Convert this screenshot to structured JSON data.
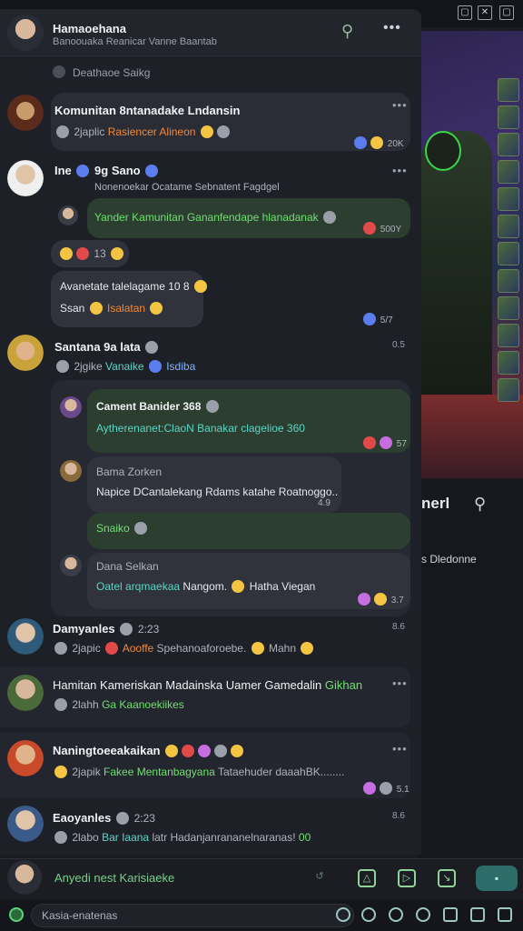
{
  "window": {
    "controls": [
      "▢",
      "✕",
      "▢"
    ]
  },
  "header": {
    "title": "Hamaoehana",
    "subtitle": "Banoouaka Reanicar Vanne Baantab",
    "search_icon": "search-icon",
    "more_label": "•••"
  },
  "system_notice": "Deathaoe Saikg",
  "group_card": {
    "name": "Komunitan 8ntanadake Lndansin",
    "sub_prefix": "2japlic",
    "sub_colored": "Rasiencer Alineon",
    "reactions": "20K",
    "more": "•••"
  },
  "thread1": {
    "name": "Ine",
    "name_extra": "9g Sano",
    "quoted": "Nonenoekar Ocatame Sebnatent Fagdgel",
    "green_msg": "Yander Kamunitan Gananfendape hlanadanak",
    "green_react": "500Y",
    "emoji_count": "13",
    "bubble_line1": "Avanetate talelagame 10 8",
    "bubble_line2_prefix": "Ssan",
    "bubble_line2_colored": "Isalatan",
    "bubble_react": "5/7"
  },
  "thread2": {
    "name": "Santana 9a lata",
    "time": "0.5",
    "sub_prefix": "2jgike",
    "sub_colored": "Vanaike",
    "sub_tail": "Isdiba",
    "quote_card": {
      "name": "Cament Banider 368",
      "text": "Aytherenanet:ClaoN Banakar clagelioe 360",
      "react": "57"
    },
    "reply1": {
      "name": "Bama Zorken",
      "text": "Napice DCantalekang Rdams katahe Roatnoggo..",
      "react": "4.9"
    },
    "reply2": {
      "text": "Snaiko"
    },
    "reply3": {
      "name": "Dana Selkan",
      "text_prefix": "Oatel arqmaekaa",
      "text_mid": "Nangom.",
      "text_tail": "Hatha Viegan",
      "react": "3.7"
    }
  },
  "chats": [
    {
      "name": "Damyanles",
      "time": "2:23",
      "stamp": "8.6",
      "prefix": "2japic",
      "colored": "Aooffe",
      "tail": "Spehanoaforoebe.",
      "tail2": "Mahn"
    },
    {
      "name": "Hamitan Kameriskan Madainska Uamer Gamedalin",
      "colored_tail": "Gikhan",
      "prefix": "2lahh",
      "colored": "Ga Kaanoekiikes"
    },
    {
      "name": "Naningtoeeakaikan",
      "prefix": "2japik",
      "colored": "Fakee Mentanbagyana",
      "tail": "Tataehuder daaahBK........",
      "react": "5.1"
    },
    {
      "name": "Eaoyanles",
      "time": "2:23",
      "stamp": "8.6",
      "prefix": "2labo",
      "colored": "Bar Iaana",
      "tail": "latr Hadanjanrananelnaranas!",
      "tail_colored": "00"
    }
  ],
  "input": {
    "placeholder": "Anyedi nest Karisiaeke",
    "send_label": "▪",
    "tool_icons": [
      "↺",
      "△",
      "▷",
      "↘"
    ]
  },
  "bottom": {
    "placeholder": "Kasia-enatenas"
  },
  "right_panel": {
    "title": "nerl",
    "subtitle": "s Dledonne"
  },
  "colors": {
    "accent": "#6fe06f",
    "orange": "#f08a3a",
    "teal": "#5ad6c6",
    "panel": "#1e2027"
  }
}
